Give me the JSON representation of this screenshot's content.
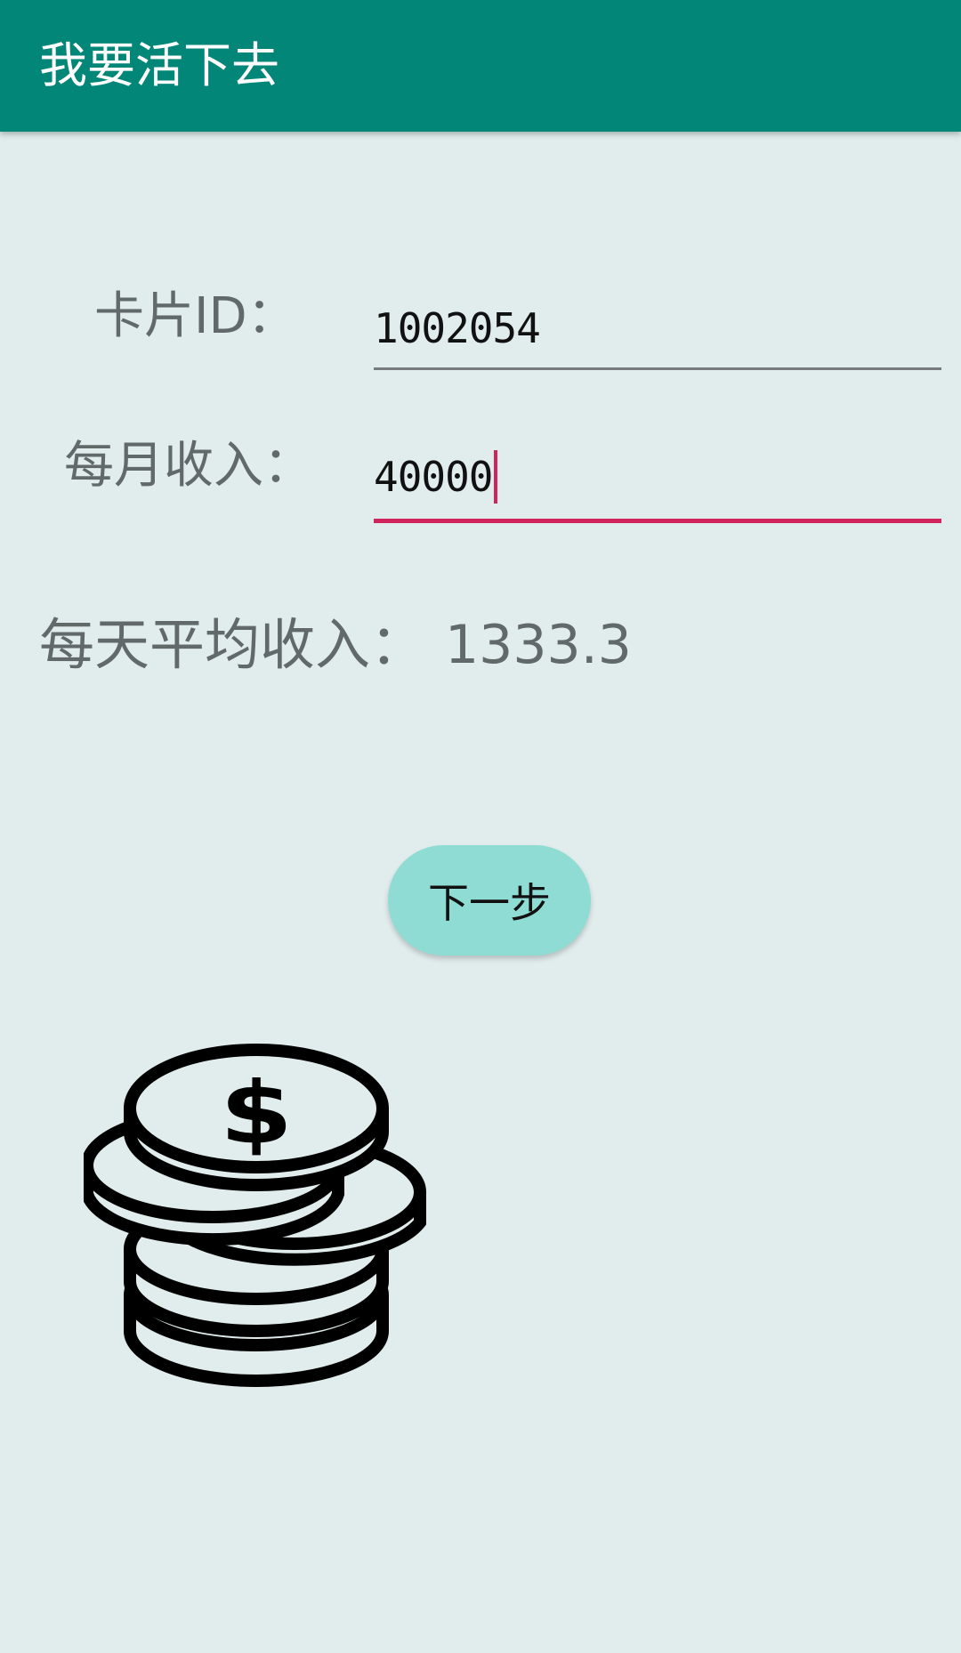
{
  "app_bar": {
    "title": "我要活下去",
    "background": "#028677"
  },
  "form": {
    "card_id": {
      "label": "卡片ID：",
      "value": "1002054"
    },
    "monthly_income": {
      "label": "每月收入：",
      "value": "40000",
      "focused": true
    }
  },
  "daily_average": {
    "label": "每天平均收入：",
    "value": "1333.3"
  },
  "next_button": {
    "label": "下一步"
  },
  "illustration": {
    "icon": "coin-stack-dollar-icon"
  },
  "colors": {
    "accent": "#d0245c",
    "button": "#8edcd3",
    "background": "#e1ecec"
  }
}
